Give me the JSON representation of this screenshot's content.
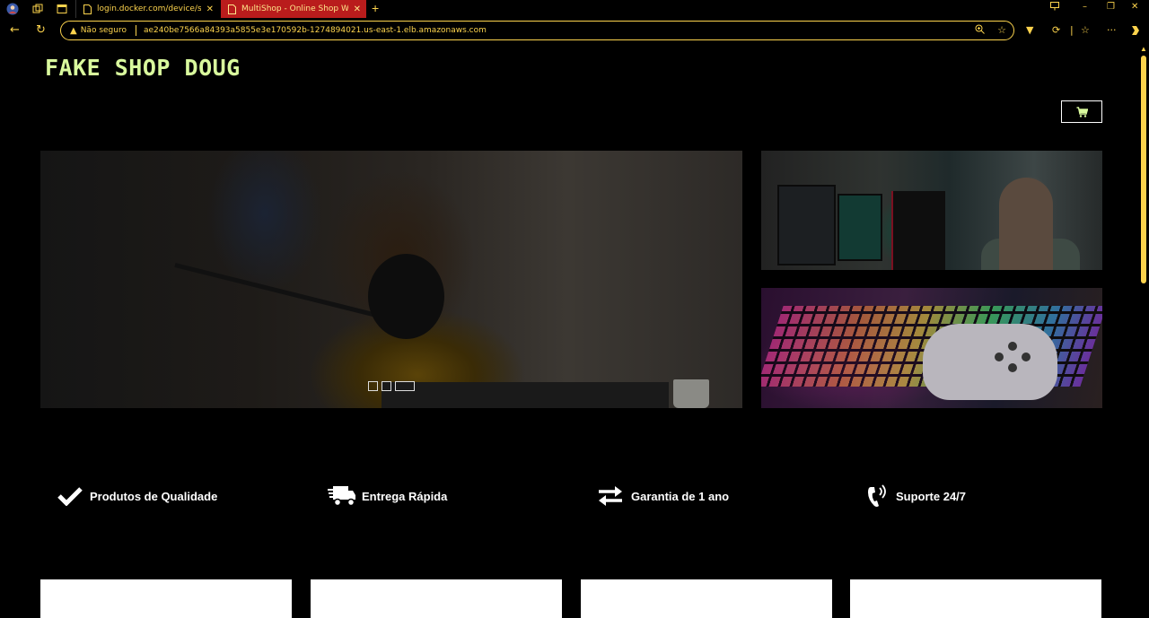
{
  "browser": {
    "tabs": [
      {
        "title": "login.docker.com/device/success",
        "active": false
      },
      {
        "title": "MultiShop - Online Shop Website",
        "active": true
      }
    ],
    "new_tab_icon": "plus-icon",
    "address": {
      "security_label": "Não seguro",
      "url": "ae240be7566a84393a5855e3e170592b-1274894021.us-east-1.elb.amazonaws.com"
    },
    "colors": {
      "chrome_accent": "#fcd34d",
      "active_tab": "#b91c1c"
    }
  },
  "site": {
    "logo": "FAKE SHOP DOUG",
    "cart_icon": "cart-icon",
    "carousel": {
      "slides": 3,
      "active_slide": 3
    },
    "features": [
      {
        "icon": "check-icon",
        "label": "Produtos de Qualidade"
      },
      {
        "icon": "truck-icon",
        "label": "Entrega Rápida"
      },
      {
        "icon": "exchange-icon",
        "label": "Garantia de 1 ano"
      },
      {
        "icon": "phone-volume-icon",
        "label": "Suporte 24/7"
      }
    ],
    "colors": {
      "logo": "#d9f99d",
      "background": "#000000"
    }
  }
}
